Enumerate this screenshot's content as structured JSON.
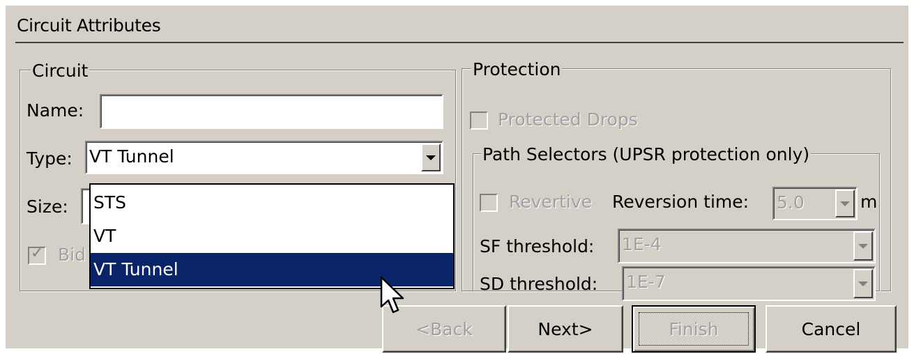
{
  "window": {
    "title": "Circuit Attributes"
  },
  "circuit": {
    "legend": "Circuit",
    "name_label": "Name:",
    "name_value": "",
    "type_label": "Type:",
    "type_value": "VT Tunnel",
    "size_label": "Size:",
    "bidirectional_label_partial": "Bid",
    "bidirectional_checked": true,
    "type_options": [
      "STS",
      "VT",
      "VT Tunnel"
    ],
    "type_selected_index": 2
  },
  "protection": {
    "legend": "Protection",
    "protected_drops_label": "Protected Drops",
    "path_selectors": {
      "legend": "Path Selectors (UPSR protection only)",
      "revertive_label": "Revertive",
      "reversion_time_label": "Reversion time:",
      "reversion_time_value": "5.0",
      "reversion_time_unit": "m",
      "sf_threshold_label": "SF threshold:",
      "sf_threshold_value": "1E-4",
      "sd_threshold_label": "SD threshold:",
      "sd_threshold_value": "1E-7"
    }
  },
  "buttons": {
    "back": "<Back",
    "next": "Next>",
    "finish": "Finish",
    "cancel": "Cancel"
  },
  "colors": {
    "dialog_bg": "#d4d0c8",
    "selection_bg": "#0a246a",
    "disabled_text": "#a0a0a0"
  }
}
